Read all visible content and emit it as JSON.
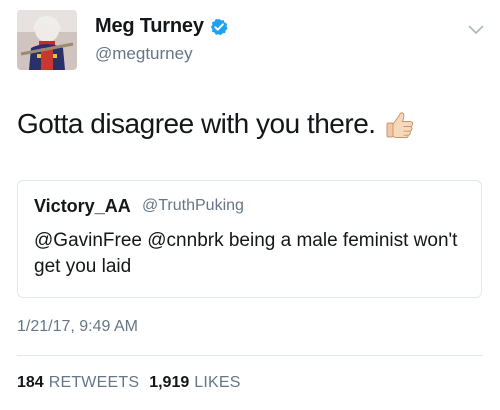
{
  "author": {
    "name": "Meg Turney",
    "handle": "@megturney",
    "verified": true
  },
  "tweet": {
    "text": "Gotta disagree with you there.",
    "emoji": "thumbs-up-icon"
  },
  "quoted_tweet": {
    "name": "Victory_AA",
    "handle": "@TruthPuking",
    "text": "@GavinFree @cnnbrk being a male feminist won't get you laid"
  },
  "timestamp": "1/21/17, 9:49 AM",
  "stats": {
    "retweets_count": "184",
    "retweets_label": "RETWEETS",
    "likes_count": "1,919",
    "likes_label": "LIKES"
  },
  "colors": {
    "verified_blue": "#1da1f2",
    "secondary_text": "#657786",
    "border": "#e1e8ed"
  }
}
